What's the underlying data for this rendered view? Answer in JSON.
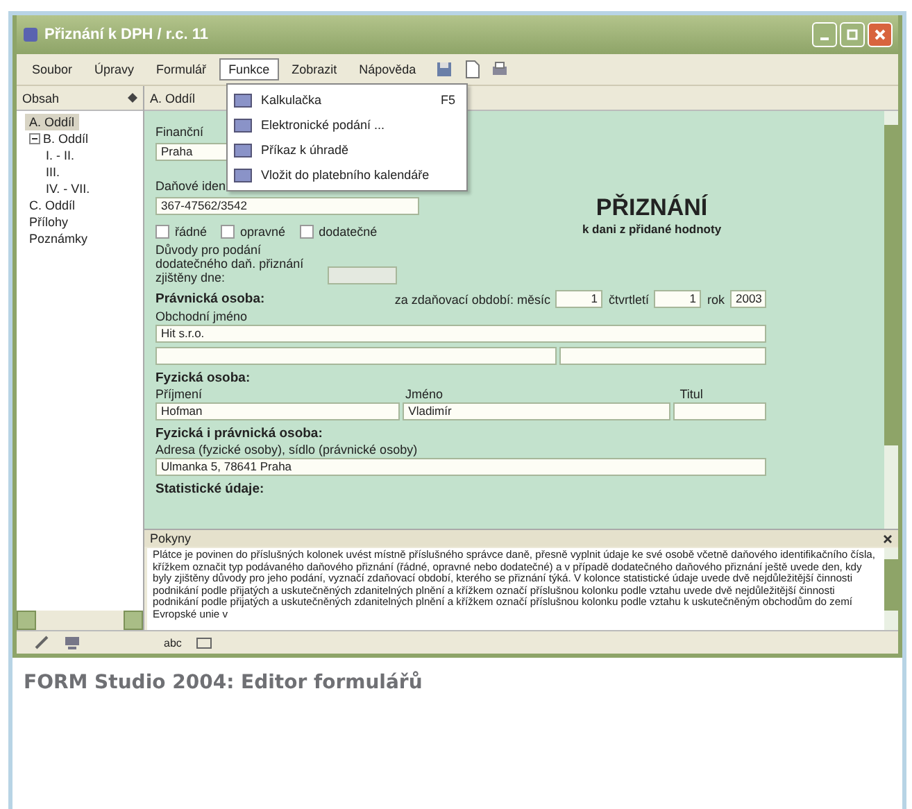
{
  "window": {
    "title": "Přiznání k DPH / r.c. 11"
  },
  "menu": [
    {
      "label": "Soubor",
      "selected": false
    },
    {
      "label": "Úpravy",
      "selected": false
    },
    {
      "label": "Formulář",
      "selected": false
    },
    {
      "label": "Funkce",
      "selected": true
    },
    {
      "label": "Zobrazit",
      "selected": false
    },
    {
      "label": "Nápověda",
      "selected": false
    }
  ],
  "dropdown": [
    {
      "label": "Kalkulačka",
      "shortcut": "F5"
    },
    {
      "label": "Elektronické podání ..."
    },
    {
      "label": "Příkaz k úhradě"
    },
    {
      "label": "Vložit do platebního kalendáře"
    }
  ],
  "sidebar": {
    "title": "Obsah",
    "items": [
      {
        "label": "A. Oddíl",
        "selected": true
      },
      {
        "label": "B. Oddíl",
        "selected": false,
        "expanded": true,
        "children": [
          {
            "label": "I. - II.",
            "selected": false
          },
          {
            "label": "III.",
            "selected": false
          },
          {
            "label": "IV. - VII.",
            "selected": false
          }
        ]
      },
      {
        "label": "C. Oddíl",
        "selected": false
      },
      {
        "label": "Přílohy",
        "selected": false
      },
      {
        "label": "Poznámky",
        "selected": false
      }
    ]
  },
  "form": {
    "section": "A. Oddíl",
    "title": "PŘIZNÁNÍ",
    "subtitle": "k dani z přidané hodnoty",
    "tax_office": {
      "label": "Finanční",
      "value": "Praha"
    },
    "tax_id": {
      "label": "Daňové iden",
      "value": "367-47562/3542"
    },
    "types": [
      {
        "label": "řádné",
        "checked": false
      },
      {
        "label": "opravné",
        "checked": false
      },
      {
        "label": "dodatečné",
        "checked": false
      }
    ],
    "reason_label": "Důvody pro podání dodatečného daň. přiznání zjištěny dne:",
    "legal_person": {
      "heading": "Právnická osoba:",
      "period_label": "za zdaňovací období: měsíc",
      "month": "1",
      "quarter_label": "čtvrtletí",
      "quarter": "1",
      "year_label": "rok",
      "year": "2003",
      "name_label": "Obchodní jméno",
      "name": "Hit s.r.o."
    },
    "natural_person": {
      "heading": "Fyzická osoba:",
      "surname_label": "Příjmení",
      "surname": "Hofman",
      "first_label": "Jméno",
      "first": "Vladimír",
      "title_label": "Titul"
    },
    "both": {
      "heading": "Fyzická i právnická osoba:",
      "address_label": "Adresa (fyzické osoby), sídlo (právnické osoby)",
      "address": "Ulmanka 5, 78641 Praha"
    },
    "stats_heading": "Statistické údaje:"
  },
  "help": {
    "title": "Pokyny",
    "text": "Plátce je povinen do příslušných kolonek uvést místně příslušného správce daně, přesně vyplnit údaje ke své osobě včetně daňového identifikačního čísla, křížkem označit typ podávaného daňového přiznání (řádné, opravné nebo dodatečné) a v případě dodatečného daňového přiznání ještě uvede den, kdy byly zjištěny důvody pro jeho podání, vyznačí zdaňovací období, kterého se přiznání týká. V kolonce statistické údaje uvede dvě nejdůležitější činnosti podnikání podle přijatých a uskutečněných zdanitelných plnění a křížkem označí příslušnou kolonku podle vztahu uvede dvě nejdůležitější činnosti podnikání podle přijatých a uskutečněných zdanitelných plnění a křížkem označí příslušnou kolonku podle vztahu k uskutečněným obchodům do zemí Evropské unie v"
  },
  "status_bar": {
    "mode": "abc"
  },
  "caption": "FORM Studio 2004: Editor formulářů"
}
